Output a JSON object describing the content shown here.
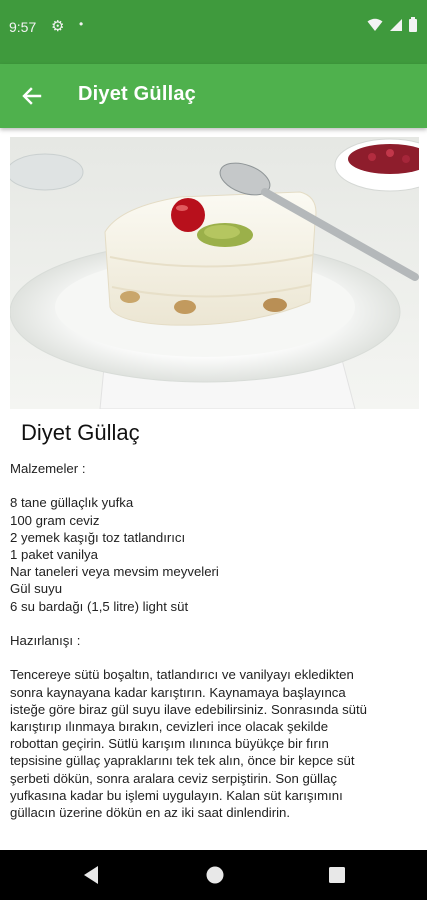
{
  "status_bar": {
    "time": "9:57",
    "icons": [
      "gear-icon",
      "dot-icon",
      "wifi-icon",
      "signal-icon",
      "battery-icon"
    ]
  },
  "app_bar": {
    "title": "Diyet Güllaç",
    "back_icon": "arrow-back-icon",
    "color": "#4fb14d"
  },
  "recipe": {
    "title": "Diyet Güllaç",
    "ingredients_heading": "Malzemeler :",
    "ingredients": [
      "8 tane güllaçlık yufka",
      "100 gram ceviz",
      "2 yemek kaşığı toz tatlandırıcı",
      "1 paket vanilya",
      "Nar taneleri veya mevsim meyveleri",
      "Gül suyu",
      "6 su bardağı (1,5 litre) light süt"
    ],
    "preparation_heading": "Hazırlanışı :",
    "preparation_lines": [
      "Tencereye sütü boşaltın, tatlandırıcı ve vanilyayı ekledikten",
      "sonra kaynayana kadar karıştırın.  Kaynamaya başlayınca",
      "isteğe göre biraz gül suyu ilave edebilirsiniz.  Sonrasında sütü",
      "karıştırıp ılınmaya bırakın,  cevizleri ince olacak şekilde",
      "robottan geçirin. Sütlü karışım ılınınca büyükçe bir fırın",
      "tepsisine güllaç yapraklarını tek tek alın, önce bir kepce süt",
      "şerbeti dökün, sonra aralara ceviz serpiştirin. Son güllaç",
      "yufkasına kadar bu işlemi uygulayın. Kalan süt karışımını",
      "güllacın üzerine dökün en az iki saat dinlendirin."
    ]
  },
  "nav_bar": {
    "icons": [
      "back-triangle-icon",
      "home-circle-icon",
      "recents-square-icon"
    ]
  }
}
